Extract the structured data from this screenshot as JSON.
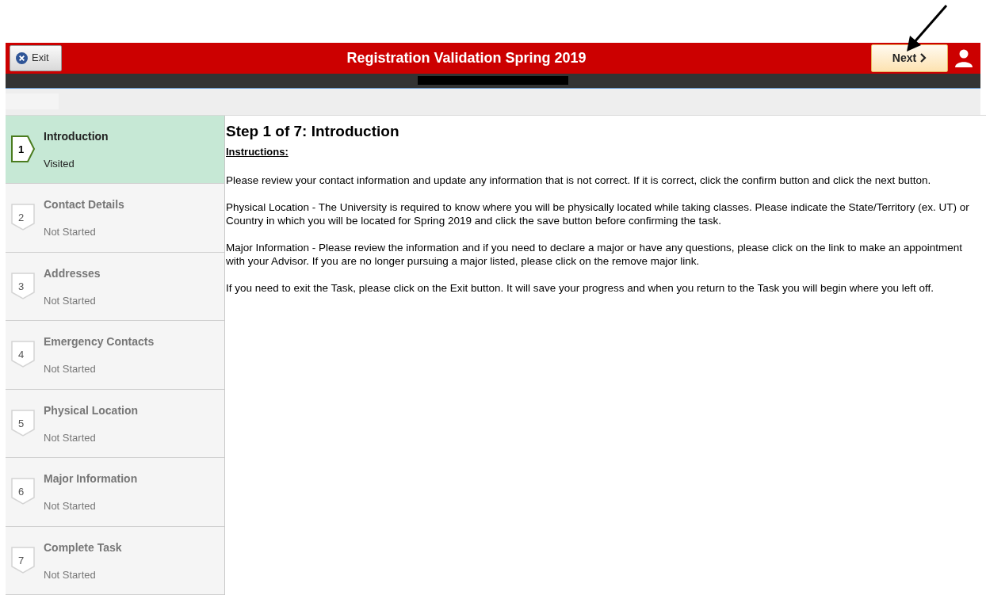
{
  "header": {
    "exit_button": "Exit",
    "title": "Registration Validation Spring 2019",
    "next_button": "Next"
  },
  "steps": [
    {
      "number": "1",
      "title": "Introduction",
      "status": "Visited",
      "selected": true
    },
    {
      "number": "2",
      "title": "Contact Details",
      "status": "Not Started",
      "selected": false
    },
    {
      "number": "3",
      "title": "Addresses",
      "status": "Not Started",
      "selected": false
    },
    {
      "number": "4",
      "title": "Emergency Contacts",
      "status": "Not Started",
      "selected": false
    },
    {
      "number": "5",
      "title": "Physical Location",
      "status": "Not Started",
      "selected": false
    },
    {
      "number": "6",
      "title": "Major Information",
      "status": "Not Started",
      "selected": false
    },
    {
      "number": "7",
      "title": "Complete Task",
      "status": "Not Started",
      "selected": false
    }
  ],
  "content": {
    "heading": "Step 1 of 7: Introduction",
    "subheading": "Instructions:",
    "paragraphs": [
      "Please review your contact information and update any information that is not correct. If it is correct, click the confirm button and click the next button.",
      "Physical Location - The University is required to know where you will be physically located while taking classes. Please indicate the State/Territory (ex. UT) or Country in which you will be located for Spring 2019 and click the save button before confirming the task.",
      "Major Information - Please review the information and if you need to declare a major or have any questions, please click on the link to make an appointment with your Advisor. If you are no longer pursuing a major listed, please click on the remove major link.",
      "If you need to exit the Task, please click on the Exit button. It will save your progress and when you return to the Task you will begin where you left off."
    ]
  }
}
